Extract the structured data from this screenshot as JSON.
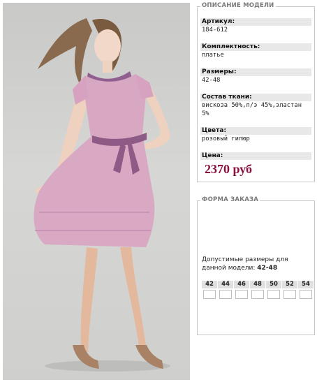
{
  "model_panel": {
    "legend": "ОПИСАНИЕ МОДЕЛИ",
    "fields": [
      {
        "label": "Артикул:",
        "value": "184-612"
      },
      {
        "label": "Комплектность:",
        "value": "платье"
      },
      {
        "label": "Размеры:",
        "value": "42-48"
      },
      {
        "label": "Состав ткани:",
        "value": "вискоза 50%,п/э 45%,эластан 5%"
      },
      {
        "label": "Цвета:",
        "value": "розовый гипюр"
      }
    ],
    "price_label": "Цена:",
    "price_value": "2370 руб"
  },
  "order_panel": {
    "legend": "ФОРМА ЗАКАЗА",
    "sizes_text": "Допустимые размеры для данной модели:",
    "sizes_range": "42-48",
    "sizes": [
      "42",
      "44",
      "46",
      "48",
      "50",
      "52",
      "54"
    ]
  },
  "colors": {
    "price": "#8b1040",
    "dress": "#d8a7c2",
    "belt": "#8e5a86"
  }
}
